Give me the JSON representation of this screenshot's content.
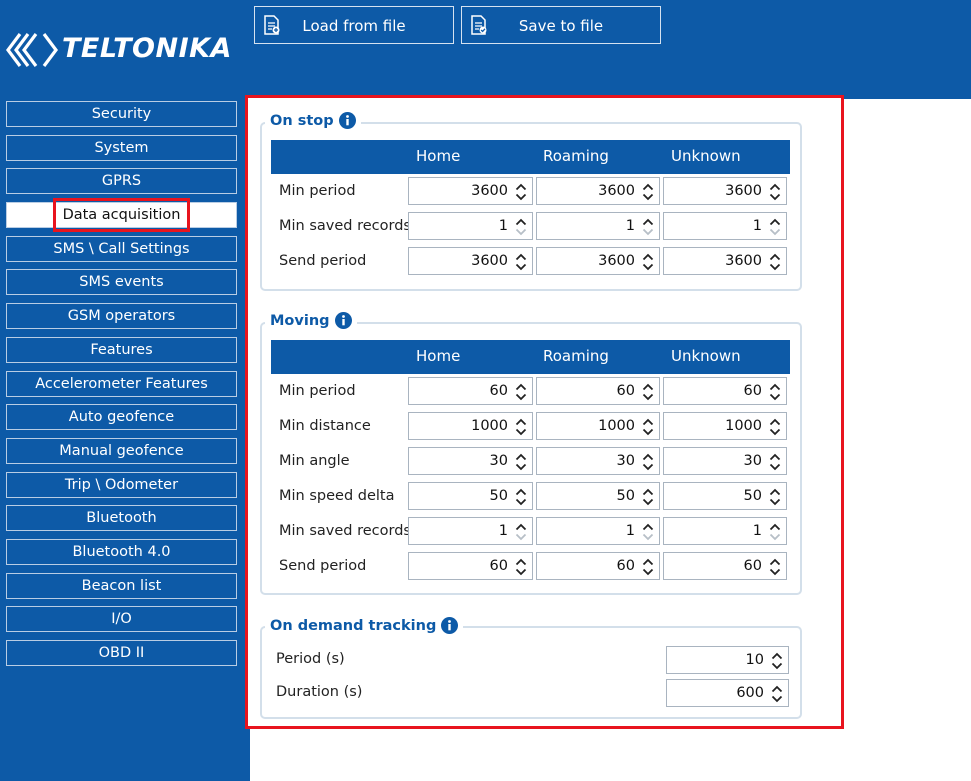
{
  "app": {
    "logo_text": "TELTONIKA"
  },
  "toolbar": {
    "load_label": "Load from file",
    "save_label": "Save to file"
  },
  "sidebar": {
    "items": [
      {
        "label": "Security"
      },
      {
        "label": "System"
      },
      {
        "label": "GPRS"
      },
      {
        "label": "Data acquisition",
        "active": true
      },
      {
        "label": "SMS \\ Call Settings"
      },
      {
        "label": "SMS events"
      },
      {
        "label": "GSM operators"
      },
      {
        "label": "Features"
      },
      {
        "label": "Accelerometer Features"
      },
      {
        "label": "Auto geofence"
      },
      {
        "label": "Manual geofence"
      },
      {
        "label": "Trip \\ Odometer"
      },
      {
        "label": "Bluetooth"
      },
      {
        "label": "Bluetooth 4.0"
      },
      {
        "label": "Beacon list"
      },
      {
        "label": "I/O"
      },
      {
        "label": "OBD II"
      }
    ]
  },
  "columns": {
    "home": "Home",
    "roaming": "Roaming",
    "unknown": "Unknown"
  },
  "on_stop": {
    "title": "On stop",
    "rows": [
      {
        "label": "Min period",
        "home": "3600",
        "roaming": "3600",
        "unknown": "3600"
      },
      {
        "label": "Min saved records",
        "home": "1",
        "roaming": "1",
        "unknown": "1"
      },
      {
        "label": "Send period",
        "home": "3600",
        "roaming": "3600",
        "unknown": "3600"
      }
    ]
  },
  "moving": {
    "title": "Moving",
    "rows": [
      {
        "label": "Min period",
        "home": "60",
        "roaming": "60",
        "unknown": "60"
      },
      {
        "label": "Min distance",
        "home": "1000",
        "roaming": "1000",
        "unknown": "1000"
      },
      {
        "label": "Min angle",
        "home": "30",
        "roaming": "30",
        "unknown": "30"
      },
      {
        "label": "Min speed delta",
        "home": "50",
        "roaming": "50",
        "unknown": "50"
      },
      {
        "label": "Min saved records",
        "home": "1",
        "roaming": "1",
        "unknown": "1"
      },
      {
        "label": "Send period",
        "home": "60",
        "roaming": "60",
        "unknown": "60"
      }
    ]
  },
  "on_demand": {
    "title": "On demand tracking",
    "rows": [
      {
        "label": "Period (s)",
        "value": "10"
      },
      {
        "label": "Duration (s)",
        "value": "600"
      }
    ]
  },
  "colors": {
    "brand": "#0d5aa7",
    "highlight": "#e8141e",
    "panel_border": "#d3dfea"
  }
}
